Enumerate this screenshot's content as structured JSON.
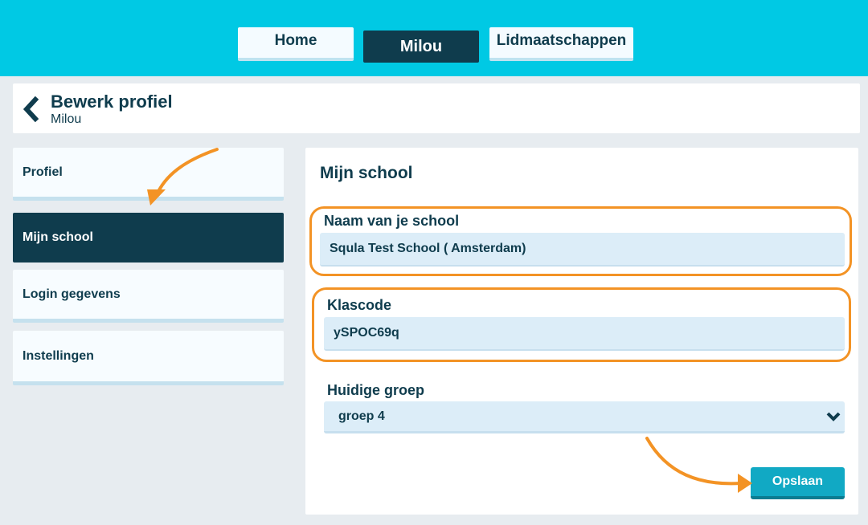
{
  "nav": {
    "home_label": "Home",
    "milou_label": "Milou",
    "memberships_label": "Lidmaatschappen"
  },
  "header": {
    "title": "Bewerk profiel",
    "subtitle": "Milou"
  },
  "sidebar": {
    "items": [
      {
        "label": "Profiel",
        "active": false
      },
      {
        "label": "Mijn school",
        "active": true
      },
      {
        "label": "Login gegevens",
        "active": false
      },
      {
        "label": "Instellingen",
        "active": false
      }
    ]
  },
  "main": {
    "section_title": "Mijn school",
    "school_label": "Naam van je school",
    "school_value": "Squla Test School ( Amsterdam)",
    "classcode_label": "Klascode",
    "classcode_value": "ySPOC69q",
    "group_label": "Huidige groep",
    "group_value": "groep 4",
    "save_label": "Opslaan"
  },
  "colors": {
    "topbar": "#00c9e4",
    "dark": "#0f3c4d",
    "highlight": "#f39325",
    "button": "#11a9c4"
  }
}
